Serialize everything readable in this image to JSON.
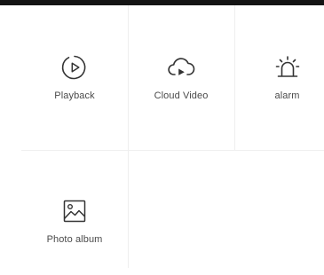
{
  "menu": {
    "items": [
      {
        "label": "Playback",
        "icon": "playback-icon"
      },
      {
        "label": "Cloud Video",
        "icon": "cloud-video-icon"
      },
      {
        "label": "alarm",
        "icon": "alarm-icon"
      },
      {
        "label": "Photo album",
        "icon": "photo-album-icon"
      }
    ]
  },
  "colors": {
    "topbar": "#141414",
    "icon_stroke": "#333333",
    "label": "#4a4a4a",
    "divider": "#efefef"
  }
}
